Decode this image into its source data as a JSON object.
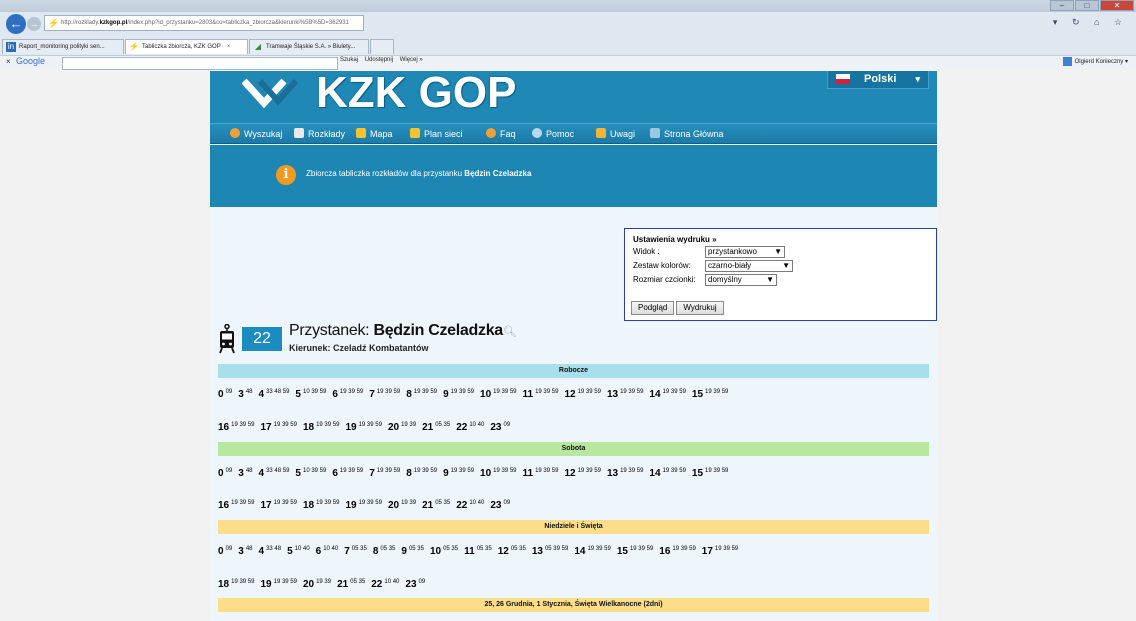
{
  "browser": {
    "url_prefix": "http://rozklady.",
    "url_host": "kzkgop.pl",
    "url_path": "/index.php?id_przystanku=2803&co=tabliczka_zbiorcza&kierunki%5B%5D=362931",
    "tabs": [
      {
        "label": "Raport_monitoring polityki sen..."
      },
      {
        "label": "Tabliczka zbiorcza, KZK GOP"
      },
      {
        "label": "Tramwaje Śląskie S.A. » Biulety..."
      }
    ],
    "toolbar": {
      "close": "×",
      "google": "Google",
      "search_btn": "Szukaj",
      "share_btn": "Udostępnij",
      "more_btn": "Więcej »",
      "user": "Olgierd Konieczny"
    }
  },
  "header": {
    "logo": "KZK GOP",
    "language": "Polski"
  },
  "menu": [
    {
      "label": "Wyszukaj",
      "color": "#f0a03a"
    },
    {
      "label": "Rozkłady",
      "color": "#e9e9e9"
    },
    {
      "label": "Mapa",
      "color": "#f3c230"
    },
    {
      "label": "Plan sieci",
      "color": "#f3c230"
    },
    {
      "label": "Faq",
      "color": "#f0a03a"
    },
    {
      "label": "Pomoc",
      "color": "#b8d8ec"
    },
    {
      "label": "Uwagi",
      "color": "#f0b43a"
    },
    {
      "label": "Strona Główna",
      "color": "#9bc7e2"
    }
  ],
  "banner": {
    "text": "Zbiorcza tabliczka rozkładów dla przystanku ",
    "stop": "Będzin Czeladzka"
  },
  "print_settings": {
    "title": "Ustawienia wydruku »",
    "view_label": "Widok :",
    "view_value": "przystankowo",
    "colors_label": "Zestaw kolorów:",
    "colors_value": "czarno-biały",
    "font_label": "Rozmiar czcionki:",
    "font_value": "domyślny",
    "preview_btn": "Podgląd",
    "print_btn": "Wydrukuj"
  },
  "stop": {
    "line": "22",
    "title_prefix": "Przystanek: ",
    "name": "Będzin Czeladzka",
    "direction": "Kierunek: Czeladź Kombatantów"
  },
  "schedule": {
    "robocze": {
      "title": "Robocze",
      "rows": [
        [
          [
            "0",
            "09"
          ],
          [
            "3",
            "48"
          ],
          [
            "4",
            "33 48 59"
          ],
          [
            "5",
            "10 39 59"
          ],
          [
            "6",
            "19 39 59"
          ],
          [
            "7",
            "19 39 59"
          ],
          [
            "8",
            "19 39 59"
          ],
          [
            "9",
            "19 39 59"
          ],
          [
            "10",
            "19 39 59"
          ],
          [
            "11",
            "19 39 59"
          ],
          [
            "12",
            "19 39 59"
          ],
          [
            "13",
            "19 39 59"
          ],
          [
            "14",
            "19 39 59"
          ],
          [
            "15",
            "19 39 59"
          ]
        ],
        [
          [
            "16",
            "19 39 59"
          ],
          [
            "17",
            "19 39 59"
          ],
          [
            "18",
            "19 39 59"
          ],
          [
            "19",
            "19 39 59"
          ],
          [
            "20",
            "19 39"
          ],
          [
            "21",
            "05 35"
          ],
          [
            "22",
            "10 40"
          ],
          [
            "23",
            "09"
          ]
        ]
      ]
    },
    "sobota": {
      "title": "Sobota",
      "rows": [
        [
          [
            "0",
            "09"
          ],
          [
            "3",
            "48"
          ],
          [
            "4",
            "33 48 59"
          ],
          [
            "5",
            "10 39 59"
          ],
          [
            "6",
            "19 39 59"
          ],
          [
            "7",
            "19 39 59"
          ],
          [
            "8",
            "19 39 59"
          ],
          [
            "9",
            "19 39 59"
          ],
          [
            "10",
            "19 39 59"
          ],
          [
            "11",
            "19 39 59"
          ],
          [
            "12",
            "19 39 59"
          ],
          [
            "13",
            "19 39 59"
          ],
          [
            "14",
            "19 39 59"
          ],
          [
            "15",
            "19 39 59"
          ]
        ],
        [
          [
            "16",
            "19 39 59"
          ],
          [
            "17",
            "19 39 59"
          ],
          [
            "18",
            "19 39 59"
          ],
          [
            "19",
            "19 39 59"
          ],
          [
            "20",
            "19 39"
          ],
          [
            "21",
            "05 35"
          ],
          [
            "22",
            "10 40"
          ],
          [
            "23",
            "09"
          ]
        ]
      ]
    },
    "niedziele": {
      "title": "Niedziele i Święta",
      "rows": [
        [
          [
            "0",
            "09"
          ],
          [
            "3",
            "48"
          ],
          [
            "4",
            "33 48"
          ],
          [
            "5",
            "10 40"
          ],
          [
            "6",
            "10 40"
          ],
          [
            "7",
            "05 35"
          ],
          [
            "8",
            "05 35"
          ],
          [
            "9",
            "05 35"
          ],
          [
            "10",
            "05 35"
          ],
          [
            "11",
            "05 35"
          ],
          [
            "12",
            "05 35"
          ],
          [
            "13",
            "05 39 59"
          ],
          [
            "14",
            "19 39 59"
          ],
          [
            "15",
            "19 39 59"
          ],
          [
            "16",
            "19 39 59"
          ],
          [
            "17",
            "19 39 59"
          ]
        ],
        [
          [
            "18",
            "19 39 59"
          ],
          [
            "19",
            "19 39 59"
          ],
          [
            "20",
            "19 39"
          ],
          [
            "21",
            "05 35"
          ],
          [
            "22",
            "10 40"
          ],
          [
            "23",
            "09"
          ]
        ]
      ]
    },
    "holidays": {
      "title": "25, 26 Grudnia, 1 Stycznia, Święta Wielkanocne (2dni)"
    }
  }
}
